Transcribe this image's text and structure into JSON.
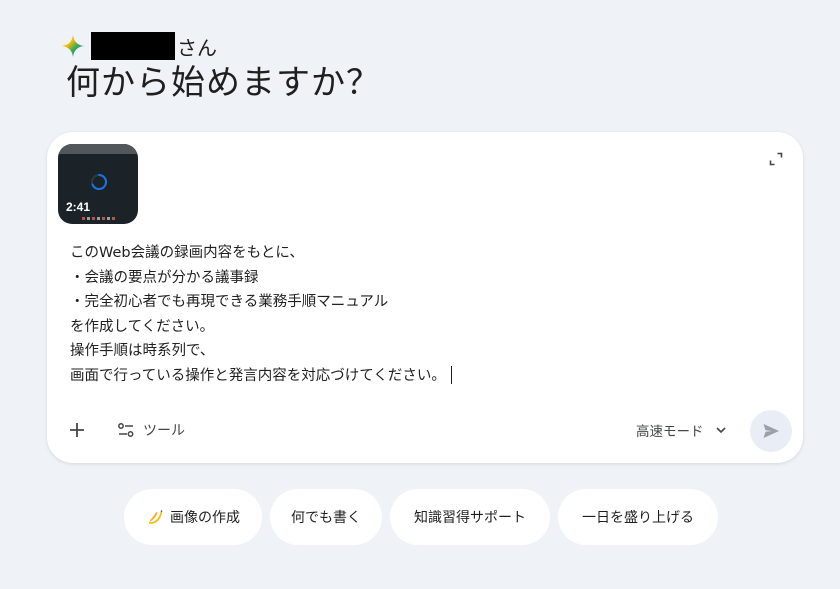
{
  "greeting": {
    "suffix": "さん"
  },
  "headline": "何から始めますか？",
  "attachment": {
    "duration": "2:41"
  },
  "prompt": {
    "lines": [
      "このWeb会議の録画内容をもとに、",
      "・会議の要点が分かる議事録",
      "・完全初心者でも再現できる業務手順マニュアル",
      "を作成してください。",
      "操作手順は時系列で、",
      "画面で行っている操作と発言内容を対応づけてください。"
    ]
  },
  "toolbar": {
    "tools_label": "ツール",
    "mode_label": "高速モード"
  },
  "chips": [
    {
      "label": "画像の作成",
      "icon": "banana-icon"
    },
    {
      "label": "何でも書く"
    },
    {
      "label": "知識習得サポート"
    },
    {
      "label": "一日を盛り上げる"
    }
  ],
  "colors": {
    "background": "#eff2f7",
    "card": "#ffffff",
    "send_button_bg": "#e9eef6",
    "text": "#1f1f1f",
    "gemini_spark": [
      "#4285f4",
      "#ea4335",
      "#fbbc04",
      "#34a853"
    ]
  }
}
